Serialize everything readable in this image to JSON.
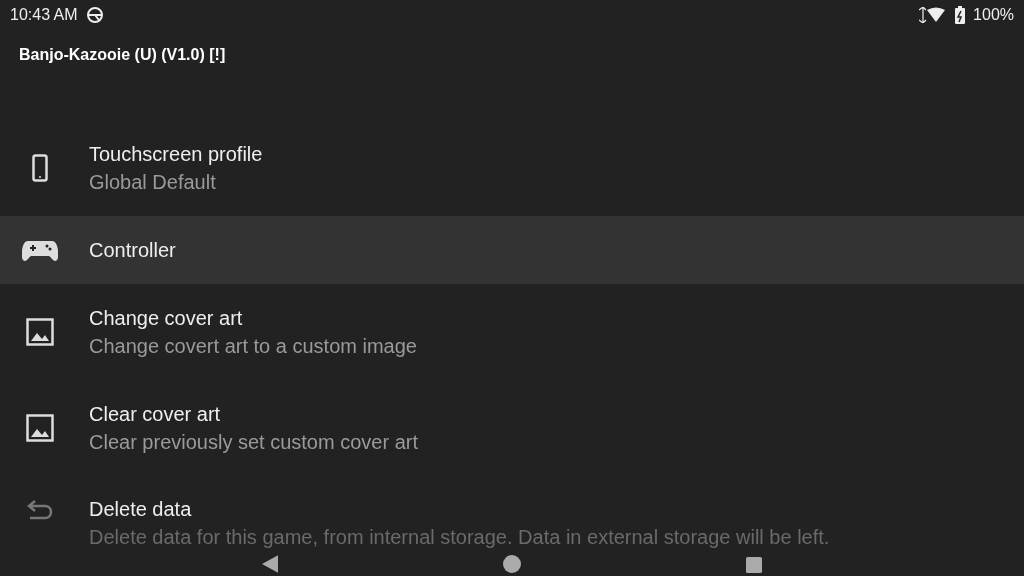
{
  "status_bar": {
    "time": "10:43 AM",
    "battery": "100%"
  },
  "header": {
    "title": "Banjo-Kazooie (U) (V1.0) [!]"
  },
  "items": [
    {
      "kind": "phone",
      "title": "Touchscreen profile",
      "subtitle": "Global Default",
      "selected": false
    },
    {
      "kind": "gamepad",
      "title": "Controller",
      "selected": true
    },
    {
      "kind": "image",
      "title": "Change cover art",
      "subtitle": "Change covert art to a custom image",
      "selected": false
    },
    {
      "kind": "image",
      "title": "Clear cover art",
      "subtitle": "Clear previously set custom cover art",
      "selected": false
    },
    {
      "kind": "undo",
      "title": "Delete data",
      "subtitle": "Delete data for this game, from internal storage. Data in external storage will be left.",
      "selected": false
    }
  ]
}
